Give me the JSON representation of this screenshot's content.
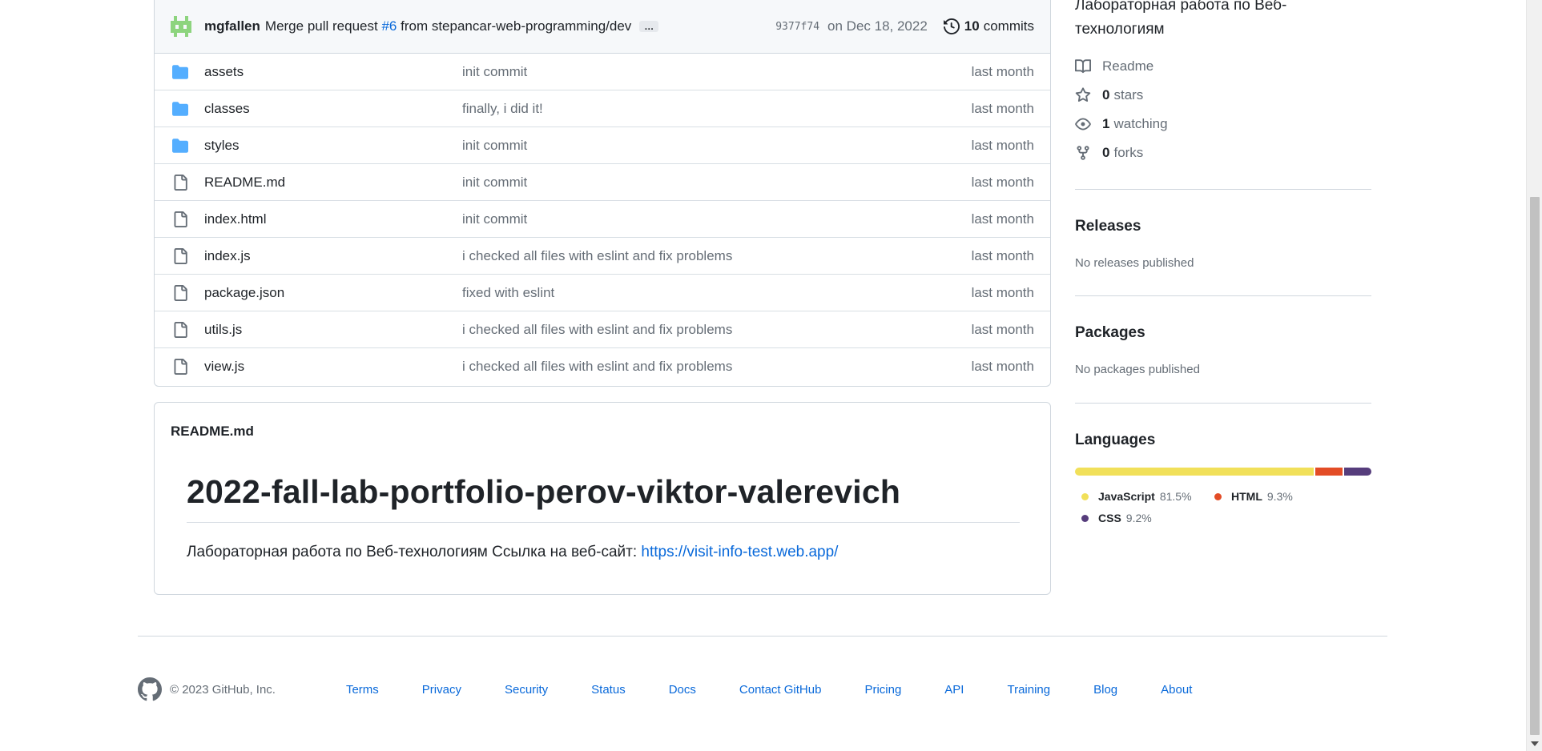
{
  "commit": {
    "author": "mgfallen",
    "message_prefix": "Merge pull request",
    "pr_link": "#6",
    "message_suffix": "from stepancar-web-programming/dev",
    "ellipsis": "…",
    "sha": "9377f74",
    "date": "on Dec 18, 2022",
    "commit_count": "10",
    "commits_label": "commits"
  },
  "files": [
    {
      "name": "assets",
      "type": "folder",
      "message": "init commit",
      "age": "last month"
    },
    {
      "name": "classes",
      "type": "folder",
      "message": "finally, i did it!",
      "age": "last month"
    },
    {
      "name": "styles",
      "type": "folder",
      "message": "init commit",
      "age": "last month"
    },
    {
      "name": "README.md",
      "type": "file",
      "message": "init commit",
      "age": "last month"
    },
    {
      "name": "index.html",
      "type": "file",
      "message": "init commit",
      "age": "last month"
    },
    {
      "name": "index.js",
      "type": "file",
      "message": "i checked all files with eslint and fix problems",
      "age": "last month"
    },
    {
      "name": "package.json",
      "type": "file",
      "message": "fixed with eslint",
      "age": "last month"
    },
    {
      "name": "utils.js",
      "type": "file",
      "message": "i checked all files with eslint and fix problems",
      "age": "last month"
    },
    {
      "name": "view.js",
      "type": "file",
      "message": "i checked all files with eslint and fix problems",
      "age": "last month"
    }
  ],
  "readme": {
    "filename": "README.md",
    "heading": "2022-fall-lab-portfolio-perov-viktor-valerevich",
    "text": "Лабораторная работа по Веб-технологиям Ссылка на веб-сайт: ",
    "link": "https://visit-info-test.web.app/"
  },
  "sidebar": {
    "description": "Лабораторная работа по Веб-технологиям",
    "readme_label": "Readme",
    "stars_count": "0",
    "stars_label": "stars",
    "watching_count": "1",
    "watching_label": "watching",
    "forks_count": "0",
    "forks_label": "forks",
    "releases_title": "Releases",
    "releases_empty": "No releases published",
    "packages_title": "Packages",
    "packages_empty": "No packages published",
    "languages_title": "Languages",
    "languages": [
      {
        "name": "JavaScript",
        "percent": "81.5%",
        "value": 81.5,
        "color": "#f1e05a"
      },
      {
        "name": "HTML",
        "percent": "9.3%",
        "value": 9.3,
        "color": "#e34c26"
      },
      {
        "name": "CSS",
        "percent": "9.2%",
        "value": 9.2,
        "color": "#563d7c"
      }
    ]
  },
  "footer": {
    "copyright": "© 2023 GitHub, Inc.",
    "links": [
      "Terms",
      "Privacy",
      "Security",
      "Status",
      "Docs",
      "Contact GitHub",
      "Pricing",
      "API",
      "Training",
      "Blog",
      "About"
    ]
  },
  "colors": {
    "link": "#0969da",
    "folder": "#54aeff",
    "muted": "#656d76"
  }
}
